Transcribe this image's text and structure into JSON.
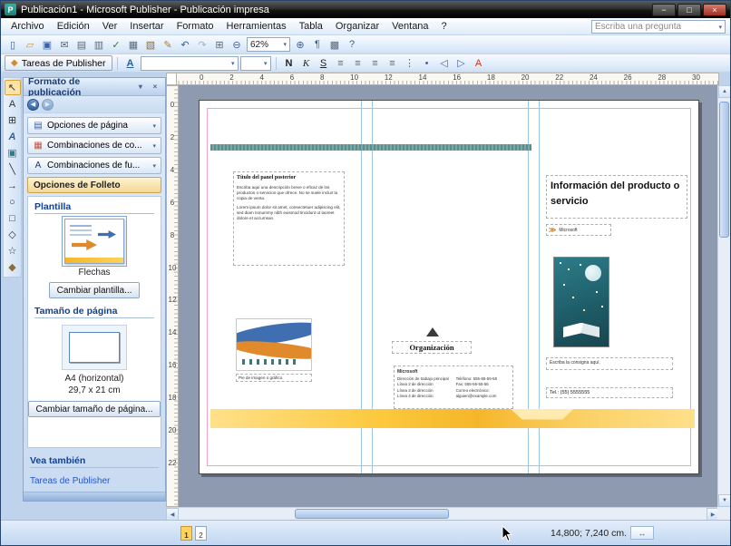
{
  "window": {
    "title": "Publicación1 - Microsoft Publisher - Publicación impresa",
    "app_initial": "P",
    "minimize_glyph": "−",
    "maximize_glyph": "□",
    "close_glyph": "×"
  },
  "ui": {
    "chevron_down": "▾"
  },
  "menubar": {
    "items": [
      {
        "name": "menu-archivo",
        "label": "Archivo"
      },
      {
        "name": "menu-edicion",
        "label": "Edición"
      },
      {
        "name": "menu-ver",
        "label": "Ver"
      },
      {
        "name": "menu-insertar",
        "label": "Insertar"
      },
      {
        "name": "menu-formato",
        "label": "Formato"
      },
      {
        "name": "menu-herramientas",
        "label": "Herramientas"
      },
      {
        "name": "menu-tabla",
        "label": "Tabla"
      },
      {
        "name": "menu-organizar",
        "label": "Organizar"
      },
      {
        "name": "menu-ventana",
        "label": "Ventana"
      },
      {
        "name": "menu-ayuda",
        "label": "?"
      }
    ],
    "question_placeholder": "Escriba una pregunta"
  },
  "standard_toolbar": {
    "icons_left": [
      {
        "name": "new-icon",
        "glyph": "▯",
        "color": "#3a62a8"
      },
      {
        "name": "open-icon",
        "glyph": "▱",
        "color": "#c9973f"
      },
      {
        "name": "save-icon",
        "glyph": "▣",
        "color": "#3a62a8"
      },
      {
        "name": "mail-icon",
        "glyph": "✉",
        "color": "#5a6b7d"
      },
      {
        "name": "print-icon",
        "glyph": "▤",
        "color": "#5a6b7d"
      },
      {
        "name": "print-preview-icon",
        "glyph": "▥",
        "color": "#5a6b7d"
      },
      {
        "name": "spelling-icon",
        "glyph": "✓",
        "color": "#2e7d32"
      },
      {
        "name": "copy-icon",
        "glyph": "▦",
        "color": "#5a6b7d"
      },
      {
        "name": "paste-icon",
        "glyph": "▧",
        "color": "#8a6d3b"
      },
      {
        "name": "format-painter-icon",
        "glyph": "✎",
        "color": "#b07c2a"
      },
      {
        "name": "undo-icon",
        "glyph": "↶",
        "color": "#2f5f9e"
      },
      {
        "name": "redo-icon",
        "glyph": "↷",
        "color": "#9fb3cc"
      },
      {
        "name": "insert-table-icon",
        "glyph": "⊞",
        "color": "#5a6b7d"
      },
      {
        "name": "zoom-out-icon",
        "glyph": "⊖",
        "color": "#3a62a8"
      }
    ],
    "zoom_value": "62%",
    "icons_right": [
      {
        "name": "zoom-in-icon",
        "glyph": "⊕",
        "color": "#3a62a8"
      },
      {
        "name": "special-characters-icon",
        "glyph": "¶",
        "color": "#3a62a8"
      },
      {
        "name": "boundaries-icon",
        "glyph": "▩",
        "color": "#5a6b7d"
      },
      {
        "name": "help-icon",
        "glyph": "?",
        "color": "#2f5f9e"
      }
    ]
  },
  "format_toolbar": {
    "tasks_button_label": "Tareas de Publisher",
    "tasks_button_glyph": "◆",
    "style_icon_glyph": "A",
    "font_value": "",
    "font_size_value": "",
    "buttons": [
      {
        "name": "bold-button",
        "glyph": "N",
        "color": "#222222"
      },
      {
        "name": "italic-button",
        "glyph": "K",
        "color": "#222222"
      },
      {
        "name": "underline-button",
        "glyph": "S",
        "color": "#222222"
      },
      {
        "name": "align-left-button",
        "glyph": "≡",
        "color": "#44679a"
      },
      {
        "name": "align-center-button",
        "glyph": "≡",
        "color": "#44679a"
      },
      {
        "name": "align-right-button",
        "glyph": "≡",
        "color": "#44679a"
      },
      {
        "name": "align-justify-button",
        "glyph": "≡",
        "color": "#44679a"
      },
      {
        "name": "numbering-button",
        "glyph": "⋮",
        "color": "#44679a"
      },
      {
        "name": "bullets-button",
        "glyph": "•",
        "color": "#44679a"
      },
      {
        "name": "decrease-indent-button",
        "glyph": "◁",
        "color": "#44679a"
      },
      {
        "name": "increase-indent-button",
        "glyph": "▷",
        "color": "#44679a"
      },
      {
        "name": "font-color-button",
        "glyph": "A",
        "color": "#c23b22"
      }
    ]
  },
  "object_toolbar": {
    "tools": [
      {
        "name": "select-tool-icon",
        "glyph": "↖",
        "color": "#333333"
      },
      {
        "name": "text-box-tool-icon",
        "glyph": "A",
        "color": "#333333"
      },
      {
        "name": "table-tool-icon",
        "glyph": "⊞",
        "color": "#333333"
      },
      {
        "name": "wordart-tool-icon",
        "glyph": "A",
        "color": "#2f5f9e"
      },
      {
        "name": "picture-frame-tool-icon",
        "glyph": "▣",
        "color": "#2e7d86"
      },
      {
        "name": "line-tool-icon",
        "glyph": "╲",
        "color": "#333333"
      },
      {
        "name": "arrow-tool-icon",
        "glyph": "→",
        "color": "#333333"
      },
      {
        "name": "oval-tool-icon",
        "glyph": "○",
        "color": "#333333"
      },
      {
        "name": "rectangle-tool-icon",
        "glyph": "□",
        "color": "#333333"
      },
      {
        "name": "autoshapes-tool-icon",
        "glyph": "◇",
        "color": "#333333"
      },
      {
        "name": "bookmark-tool-icon",
        "glyph": "☆",
        "color": "#333333"
      },
      {
        "name": "design-gallery-tool-icon",
        "glyph": "◆",
        "color": "#8a6d3b"
      }
    ]
  },
  "task_pane": {
    "title": "Formato de publicación",
    "menu_glyph": "▾",
    "close_glyph": "×",
    "nav_back_glyph": "◀",
    "nav_forward_glyph": "▶",
    "buttons": [
      {
        "name": "page-options-button",
        "label": "Opciones de página",
        "glyph": "▤",
        "color": "#3a62a8",
        "chev": "▾"
      },
      {
        "name": "color-schemes-button",
        "label": "Combinaciones de co...",
        "glyph": "▦",
        "color": "#c2543c",
        "chev": "▾"
      },
      {
        "name": "font-schemes-button",
        "label": "Combinaciones de fu...",
        "glyph": "A",
        "color": "#1d3c6e",
        "chev": "▾"
      }
    ],
    "active_section_label": "Opciones de Folleto",
    "plantilla_heading": "Plantilla",
    "template_name": "Flechas",
    "change_template_button": "Cambiar plantilla...",
    "page_size_heading": "Tamaño de página",
    "page_size_name": "A4 (horizontal)",
    "page_size_dims": "29,7 x 21 cm",
    "change_size_button": "Cambiar tamaño de página...",
    "see_also_heading": "Vea también",
    "see_also_link": "Tareas de Publisher"
  },
  "rulers": {
    "horizontal": [
      "0",
      "2",
      "4",
      "6",
      "8",
      "10",
      "12",
      "14",
      "16",
      "18",
      "20",
      "22",
      "24",
      "26",
      "28",
      "30"
    ],
    "vertical": [
      "0",
      "2",
      "4",
      "6",
      "8",
      "10",
      "12",
      "14",
      "16",
      "18",
      "20",
      "22"
    ]
  },
  "brochure": {
    "back_panel": {
      "title": "Título del panel posterior",
      "body1": "Escriba aquí una descripción breve o eficaz de los productos o servicios que ofrece. No se suele incluir la copia de venta.",
      "body2": "Lorem ipsum dolor sit amet, consectetuer adipiscing elit, sed diam nonummy nibh euismod tincidunt ut laoreet dolore et accumsan.",
      "caption": "Pie de imagen o gráfico."
    },
    "address_panel": {
      "organization": "Organización",
      "company": "Microsoft",
      "address_lines": [
        "Dirección de trabajo principal",
        "Línea 2 de dirección",
        "Línea 3 de dirección",
        "Línea 4 de dirección"
      ],
      "contact_lines": [
        "Teléfono: 555-55-55-55",
        "Fax: 555-55-55-55",
        "Correo electrónico:",
        "alguien@example.com"
      ]
    },
    "front_panel": {
      "title": "Información del producto o servicio",
      "chevrons": "≫",
      "company": "Microsoft",
      "tagline": "Escriba la consigna aquí.",
      "phone": "Tel.: (55) 5555555"
    }
  },
  "scrollbars": {
    "up": "▲",
    "down": "▼",
    "left": "◀",
    "right": "▶"
  },
  "status_bar": {
    "pages": [
      "1",
      "2"
    ],
    "position": "14,800; 7,240 cm.",
    "size_icon_glyph": "↔"
  },
  "colors": {
    "teal_bar": "#5a8e8c",
    "accent_yellow": "#f9c63c",
    "fold_guide_blue": "#9cc4e6",
    "margin_guide_pink": "#f4a0c8"
  }
}
